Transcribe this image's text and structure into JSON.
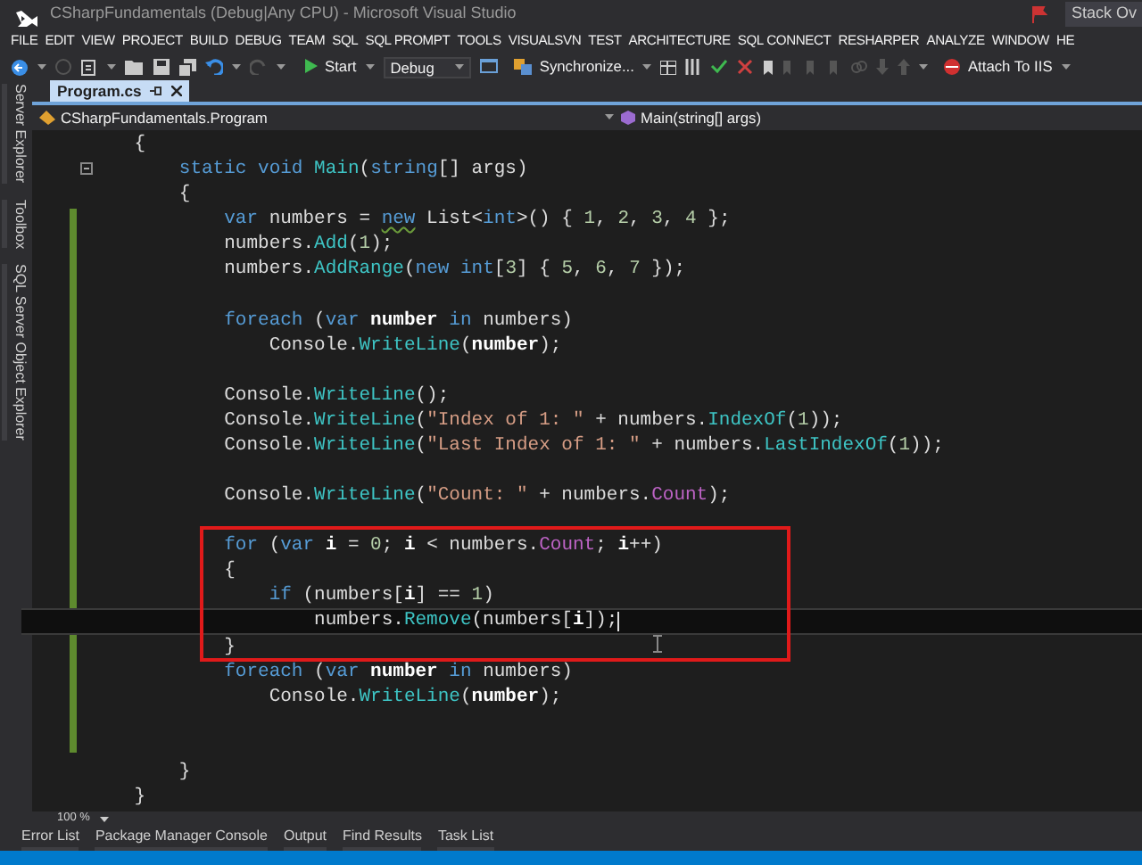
{
  "window": {
    "title": "CSharpFundamentals (Debug|Any CPU) - Microsoft Visual Studio",
    "account": "Stack Ov"
  },
  "menu": [
    "FILE",
    "EDIT",
    "VIEW",
    "PROJECT",
    "BUILD",
    "DEBUG",
    "TEAM",
    "SQL",
    "SQL PROMPT",
    "TOOLS",
    "VISUALSVN",
    "TEST",
    "ARCHITECTURE",
    "SQL CONNECT",
    "RESHARPER",
    "ANALYZE",
    "WINDOW",
    "HE"
  ],
  "toolbar": {
    "start": "Start",
    "configuration": "Debug",
    "synchronize": "Synchronize...",
    "attach": "Attach To IIS"
  },
  "side_tabs": [
    "Server Explorer",
    "Toolbox",
    "SQL Server Object Explorer"
  ],
  "tabs": [
    {
      "label": "Program.cs",
      "selected": true
    }
  ],
  "navigation": {
    "type": "CSharpFundamentals.Program",
    "member": "Main(string[] args)"
  },
  "code_lines": [
    {
      "boxed": false,
      "current": false,
      "tokens": [
        {
          "kind": "plain",
          "text": "    {"
        }
      ]
    },
    {
      "boxed": false,
      "current": false,
      "tokens": [
        {
          "kind": "keyword",
          "text": "        static void"
        },
        {
          "kind": "method",
          "text": " Main"
        },
        {
          "kind": "plain",
          "text": "("
        },
        {
          "kind": "keyword",
          "text": "string"
        },
        {
          "kind": "plain",
          "text": "[] args)"
        }
      ]
    },
    {
      "boxed": false,
      "current": false,
      "tokens": [
        {
          "kind": "plain",
          "text": "        {"
        }
      ]
    },
    {
      "boxed": false,
      "current": false,
      "tokens": [
        {
          "kind": "keyword",
          "text": "            var"
        },
        {
          "kind": "plain",
          "text": " numbers = "
        },
        {
          "kind": "warned_keyword",
          "text": "new"
        },
        {
          "kind": "plain",
          "text": " List<"
        },
        {
          "kind": "keyword",
          "text": "int"
        },
        {
          "kind": "plain",
          "text": ">() { "
        },
        {
          "kind": "number",
          "text": "1"
        },
        {
          "kind": "plain",
          "text": ", "
        },
        {
          "kind": "number",
          "text": "2"
        },
        {
          "kind": "plain",
          "text": ", "
        },
        {
          "kind": "number",
          "text": "3"
        },
        {
          "kind": "plain",
          "text": ", "
        },
        {
          "kind": "number",
          "text": "4"
        },
        {
          "kind": "plain",
          "text": " };"
        }
      ]
    },
    {
      "boxed": false,
      "current": false,
      "tokens": [
        {
          "kind": "plain",
          "text": "            numbers."
        },
        {
          "kind": "method",
          "text": "Add"
        },
        {
          "kind": "plain",
          "text": "("
        },
        {
          "kind": "number",
          "text": "1"
        },
        {
          "kind": "plain",
          "text": ");"
        }
      ]
    },
    {
      "boxed": false,
      "current": false,
      "tokens": [
        {
          "kind": "plain",
          "text": "            numbers."
        },
        {
          "kind": "method",
          "text": "AddRange"
        },
        {
          "kind": "plain",
          "text": "("
        },
        {
          "kind": "keyword",
          "text": "new int"
        },
        {
          "kind": "plain",
          "text": "["
        },
        {
          "kind": "number",
          "text": "3"
        },
        {
          "kind": "plain",
          "text": "] { "
        },
        {
          "kind": "number",
          "text": "5"
        },
        {
          "kind": "plain",
          "text": ", "
        },
        {
          "kind": "number",
          "text": "6"
        },
        {
          "kind": "plain",
          "text": ", "
        },
        {
          "kind": "number",
          "text": "7"
        },
        {
          "kind": "plain",
          "text": " });"
        }
      ]
    },
    {
      "boxed": false,
      "current": false
    },
    {
      "boxed": false,
      "current": false,
      "tokens": [
        {
          "kind": "keyword",
          "text": "            foreach"
        },
        {
          "kind": "plain",
          "text": " ("
        },
        {
          "kind": "keyword",
          "text": "var"
        },
        {
          "kind": "local",
          "text": " number"
        },
        {
          "kind": "keyword",
          "text": " in"
        },
        {
          "kind": "plain",
          "text": " numbers)"
        }
      ]
    },
    {
      "boxed": false,
      "current": false,
      "tokens": [
        {
          "kind": "plain",
          "text": "                Console."
        },
        {
          "kind": "method",
          "text": "WriteLine"
        },
        {
          "kind": "plain",
          "text": "("
        },
        {
          "kind": "local",
          "text": "number"
        },
        {
          "kind": "plain",
          "text": ");"
        }
      ]
    },
    {
      "boxed": false,
      "current": false
    },
    {
      "boxed": false,
      "current": false,
      "tokens": [
        {
          "kind": "plain",
          "text": "            Console."
        },
        {
          "kind": "method",
          "text": "WriteLine"
        },
        {
          "kind": "plain",
          "text": "();"
        }
      ]
    },
    {
      "boxed": false,
      "current": false,
      "tokens": [
        {
          "kind": "plain",
          "text": "            Console."
        },
        {
          "kind": "method",
          "text": "WriteLine"
        },
        {
          "kind": "plain",
          "text": "("
        },
        {
          "kind": "string",
          "text": "\"Index of 1: \""
        },
        {
          "kind": "plain",
          "text": " + numbers."
        },
        {
          "kind": "method",
          "text": "IndexOf"
        },
        {
          "kind": "plain",
          "text": "("
        },
        {
          "kind": "number",
          "text": "1"
        },
        {
          "kind": "plain",
          "text": "));"
        }
      ]
    },
    {
      "boxed": false,
      "current": false,
      "tokens": [
        {
          "kind": "plain",
          "text": "            Console."
        },
        {
          "kind": "method",
          "text": "WriteLine"
        },
        {
          "kind": "plain",
          "text": "("
        },
        {
          "kind": "string",
          "text": "\"Last Index of 1: \""
        },
        {
          "kind": "plain",
          "text": " + numbers."
        },
        {
          "kind": "method",
          "text": "LastIndexOf"
        },
        {
          "kind": "plain",
          "text": "("
        },
        {
          "kind": "number",
          "text": "1"
        },
        {
          "kind": "plain",
          "text": "));"
        }
      ]
    },
    {
      "boxed": false,
      "current": false
    },
    {
      "boxed": false,
      "current": false,
      "tokens": [
        {
          "kind": "plain",
          "text": "            Console."
        },
        {
          "kind": "method",
          "text": "WriteLine"
        },
        {
          "kind": "plain",
          "text": "("
        },
        {
          "kind": "string",
          "text": "\"Count: \""
        },
        {
          "kind": "plain",
          "text": " + numbers."
        },
        {
          "kind": "property",
          "text": "Count"
        },
        {
          "kind": "plain",
          "text": ");"
        }
      ]
    },
    {
      "boxed": false,
      "current": false
    },
    {
      "boxed": true,
      "current": false,
      "tokens": [
        {
          "kind": "keyword",
          "text": "            for"
        },
        {
          "kind": "plain",
          "text": " ("
        },
        {
          "kind": "keyword",
          "text": "var"
        },
        {
          "kind": "local",
          "text": " i"
        },
        {
          "kind": "plain",
          "text": " = "
        },
        {
          "kind": "number",
          "text": "0"
        },
        {
          "kind": "plain",
          "text": "; "
        },
        {
          "kind": "local",
          "text": "i"
        },
        {
          "kind": "plain",
          "text": " < numbers."
        },
        {
          "kind": "property",
          "text": "Count"
        },
        {
          "kind": "plain",
          "text": "; "
        },
        {
          "kind": "local",
          "text": "i"
        },
        {
          "kind": "plain",
          "text": "++)"
        }
      ]
    },
    {
      "boxed": true,
      "current": false,
      "tokens": [
        {
          "kind": "plain",
          "text": "            {"
        }
      ]
    },
    {
      "boxed": true,
      "current": false,
      "tokens": [
        {
          "kind": "keyword",
          "text": "                if"
        },
        {
          "kind": "plain",
          "text": " (numbers["
        },
        {
          "kind": "local",
          "text": "i"
        },
        {
          "kind": "plain",
          "text": "] == "
        },
        {
          "kind": "number",
          "text": "1"
        },
        {
          "kind": "plain",
          "text": ")"
        }
      ]
    },
    {
      "boxed": true,
      "current": true,
      "tokens": [
        {
          "kind": "plain",
          "text": "                    numbers."
        },
        {
          "kind": "method",
          "text": "Remove"
        },
        {
          "kind": "plain",
          "text": "(numbers["
        },
        {
          "kind": "local",
          "text": "i"
        },
        {
          "kind": "plain",
          "text": "]);"
        }
      ]
    },
    {
      "boxed": true,
      "current": false,
      "tokens": [
        {
          "kind": "plain",
          "text": "            }"
        }
      ]
    },
    {
      "boxed": false,
      "current": false,
      "tokens": [
        {
          "kind": "keyword",
          "text": "            foreach"
        },
        {
          "kind": "plain",
          "text": " ("
        },
        {
          "kind": "keyword",
          "text": "var"
        },
        {
          "kind": "local",
          "text": " number"
        },
        {
          "kind": "keyword",
          "text": " in"
        },
        {
          "kind": "plain",
          "text": " numbers)"
        }
      ]
    },
    {
      "boxed": false,
      "current": false,
      "tokens": [
        {
          "kind": "plain",
          "text": "                Console."
        },
        {
          "kind": "method",
          "text": "WriteLine"
        },
        {
          "kind": "plain",
          "text": "("
        },
        {
          "kind": "local",
          "text": "number"
        },
        {
          "kind": "plain",
          "text": ");"
        }
      ]
    },
    {
      "boxed": false,
      "current": false
    },
    {
      "boxed": false,
      "current": false
    },
    {
      "boxed": false,
      "current": false,
      "tokens": [
        {
          "kind": "plain",
          "text": "        }"
        }
      ]
    },
    {
      "boxed": false,
      "current": false,
      "tokens": [
        {
          "kind": "plain",
          "text": "    }"
        }
      ]
    }
  ],
  "zoom": "100 %",
  "bottom_tabs": [
    {
      "label": "Error List",
      "selected": false
    },
    {
      "label": "Package Manager Console",
      "selected": false
    },
    {
      "label": "Output",
      "selected": false
    },
    {
      "label": "Find Results",
      "selected": false
    },
    {
      "label": "Task List",
      "selected": false
    }
  ]
}
